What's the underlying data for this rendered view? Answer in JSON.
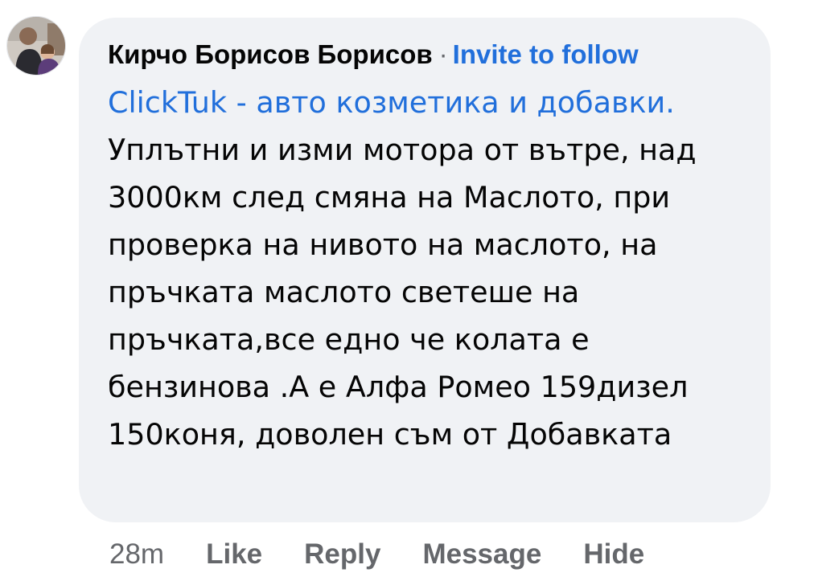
{
  "comment": {
    "author": "Кирчо Борисов Борисов",
    "separator": "·",
    "invite_label": "Invite to follow",
    "mention": "ClickTuk - авто козметика и добавки.",
    "text": "Уплътни и изми мотора от вътре, над 3000км след смяна на Маслото, при проверка на нивото на маслото, на пръчката маслото светеше на пръчката,все едно че колата е бензинова .А е Алфа Ромео 159дизел 150коня, доволен съм от Добавката",
    "avatar_icon": "profile-photo",
    "colors": {
      "bubble": "#f0f2f5",
      "link": "#216fdb",
      "meta": "#65676b",
      "text": "#050505"
    }
  },
  "actions": {
    "time": "28m",
    "like": "Like",
    "reply": "Reply",
    "message": "Message",
    "hide": "Hide"
  }
}
